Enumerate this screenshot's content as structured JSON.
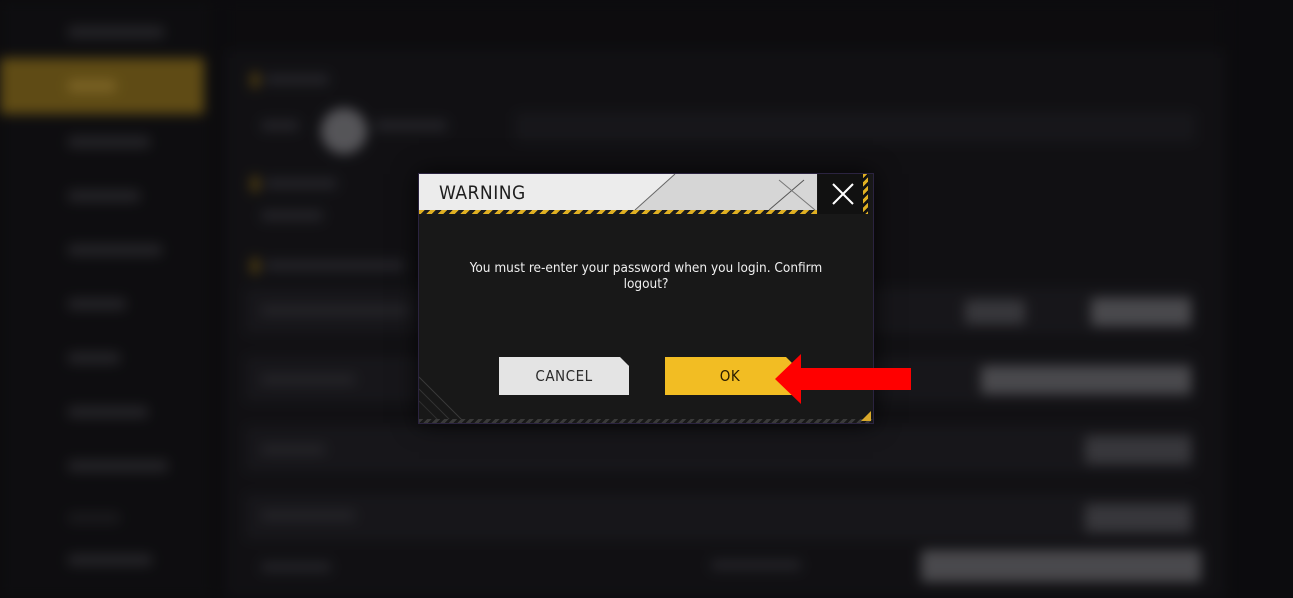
{
  "dialog": {
    "title": "WARNING",
    "message": "You must re-enter your password when you login. Confirm logout?",
    "cancel_label": "CANCEL",
    "ok_label": "OK",
    "close_icon": "close-icon"
  },
  "annotation": {
    "arrow_color": "#ff0000",
    "arrow_icon": "left-arrow-icon"
  },
  "colors": {
    "accent_yellow": "#f2bd23",
    "dialog_bg": "#181818",
    "header_bg": "#ececec"
  }
}
